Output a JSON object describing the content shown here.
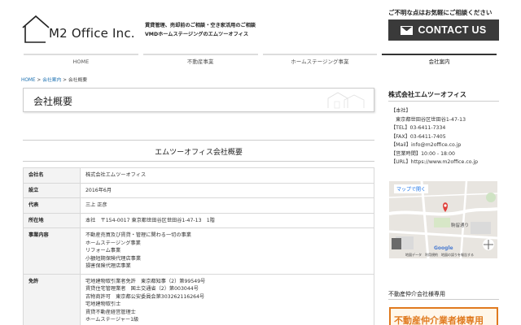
{
  "header": {
    "logo_text": "M2 Office Inc.",
    "tagline_1": "賃貸管理、売却前のご相談・空き家活用のご相談",
    "tagline_2": "VMDホームステージングのエムツーオフィス",
    "contact_note": "ご不明な点はお気軽にご相談ください",
    "contact_button": "CONTACT US"
  },
  "nav": [
    {
      "label": "HOME"
    },
    {
      "label": "不動産事業"
    },
    {
      "label": "ホームステージング事業"
    },
    {
      "label": "会社案内"
    }
  ],
  "breadcrumb": {
    "home": "HOME",
    "sep1": " > ",
    "mid": "会社案内",
    "sep2": " > ",
    "current": "会社概要"
  },
  "page_title": "会社概要",
  "section_title": "エムツーオフィス会社概要",
  "table": [
    {
      "key": "会社名",
      "lines": [
        "株式会社エムツーオフィス"
      ]
    },
    {
      "key": "設立",
      "lines": [
        "2016年6月"
      ]
    },
    {
      "key": "代表",
      "lines": [
        "三上 正彦"
      ]
    },
    {
      "key": "所在地",
      "lines": [
        "本社　〒154-0017 東京都世田谷区世田谷1-47-13　1階"
      ]
    },
    {
      "key": "事業内容",
      "lines": [
        "不動産売買及び賃貸・管理に関わる一切の事業",
        "ホームステージング事業",
        "リフォーム事業",
        "小額短期保険代理店事業",
        "損害保険代理店事業"
      ]
    },
    {
      "key": "免許",
      "lines": [
        "宅地建物取引業者免許　東京都知事（2）第99549号",
        "賃貸住宅管理業者　国土交通省（2）第003044号",
        "古物商許可　東京都公安委員会第303262116264号",
        "宅地建物取引士",
        "賃貸不動産経営管理士",
        "ホームステージャー1級"
      ]
    }
  ],
  "sidebar": {
    "company_name": "株式会社エムツーオフィス",
    "info": [
      {
        "text": "【本社】",
        "indent": false
      },
      {
        "text": "東京都世田谷区世田谷1-47-13",
        "indent": true
      },
      {
        "text": "【TEL】03-6411-7334",
        "indent": false
      },
      {
        "text": "【FAX】03-6411-7405",
        "indent": false
      },
      {
        "text": "【Mail】info@m2office.co.jp",
        "indent": false
      },
      {
        "text": "【営業時間】10:00 - 18:00",
        "indent": false
      },
      {
        "text": "【URL】https://www.m2office.co.jp",
        "indent": false
      }
    ],
    "map": {
      "open_label": "マップで開く",
      "road_label": "駒留通り",
      "attribution": "地図データ　利用規約　地図の誤りを報告する",
      "brand": "Google"
    },
    "section2_title": "不動産仲介会社様専用",
    "banner_text": "不動産仲介業者様専用"
  }
}
